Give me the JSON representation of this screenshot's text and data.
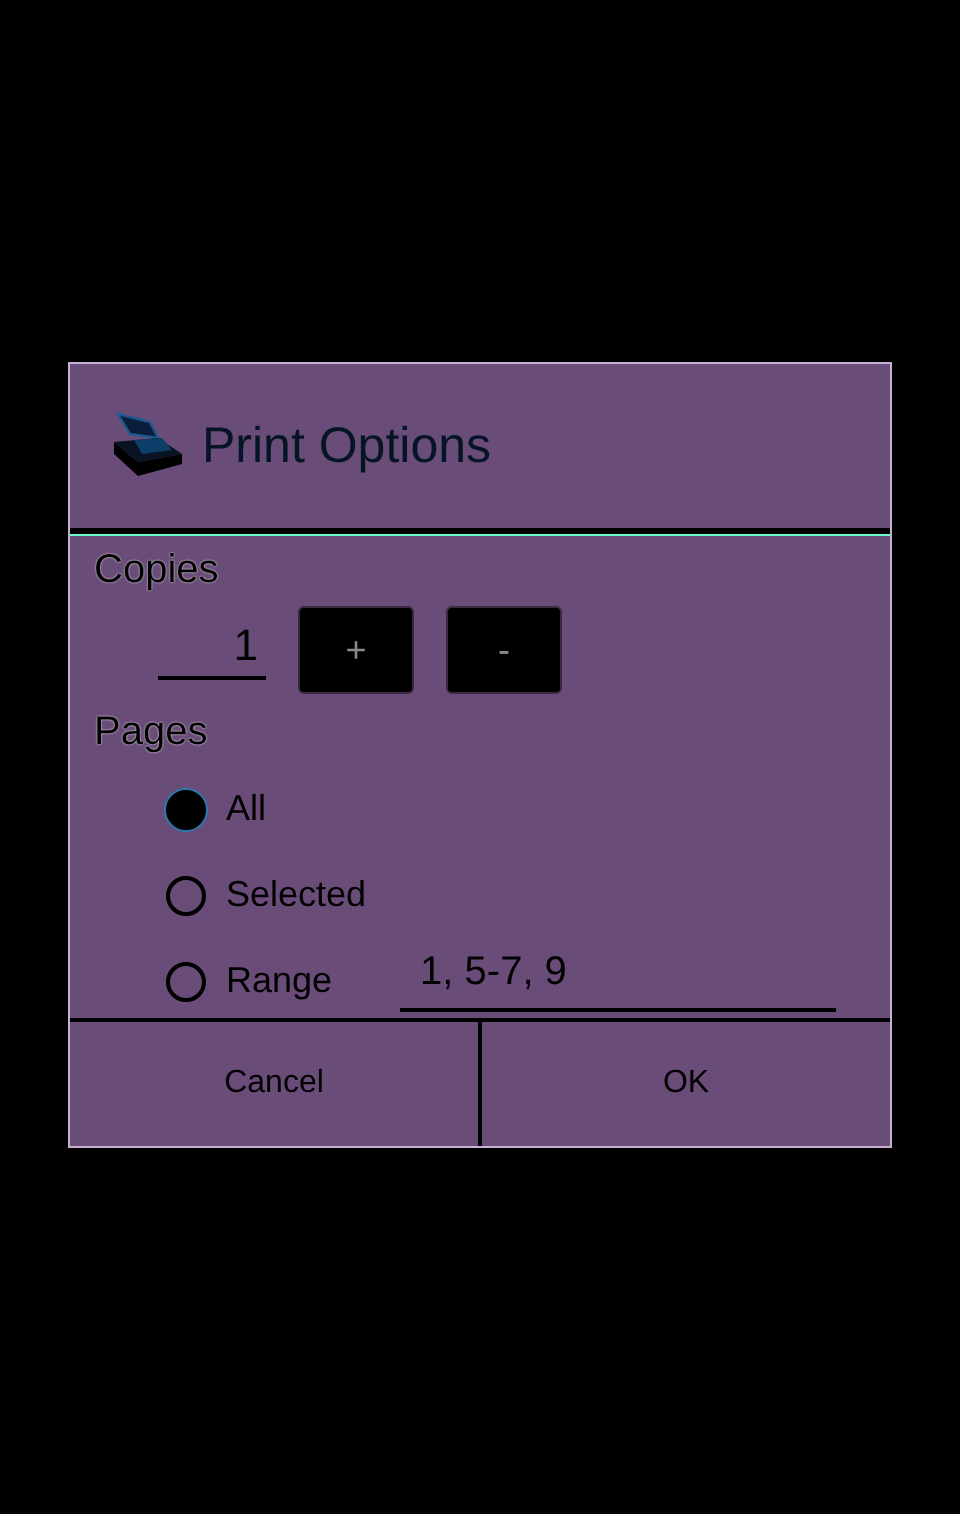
{
  "dialog": {
    "title": "Print Options"
  },
  "copies": {
    "label": "Copies",
    "value": "1",
    "buttons": [
      "+",
      "-"
    ]
  },
  "pages": {
    "label": "Pages",
    "options": [
      {
        "label": "All",
        "selected": true
      },
      {
        "label": "Selected",
        "selected": false
      },
      {
        "label": "Range",
        "selected": false,
        "kind": "range",
        "value": "1, 5-7, 9"
      }
    ]
  },
  "buttons": [
    "Cancel",
    "OK"
  ]
}
